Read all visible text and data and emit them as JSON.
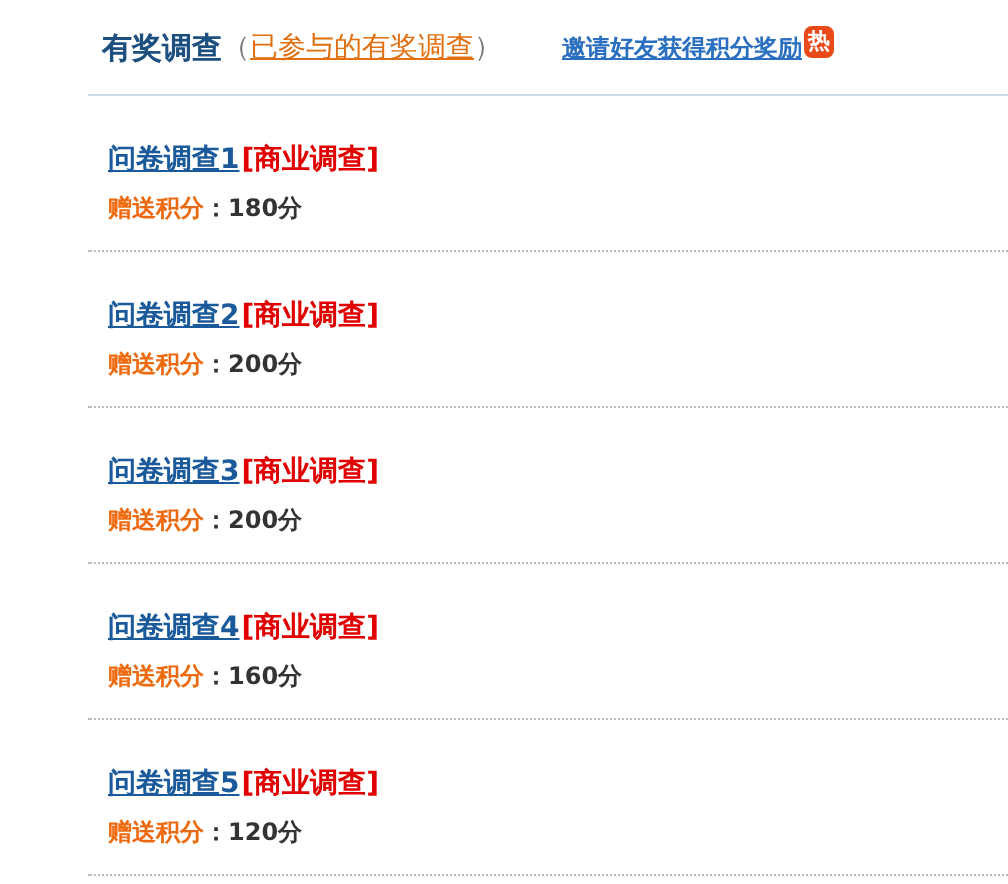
{
  "header": {
    "title": "有奖调查",
    "paren_open": "（",
    "participated_link": "已参与的有奖调查",
    "paren_close": "）",
    "invite_link": "邀请好友获得积分奖励",
    "hot_badge": "热"
  },
  "surveys": [
    {
      "title": "问卷调查1",
      "tag": "[商业调查]",
      "points_label": "赠送积分",
      "points_value": "：180分"
    },
    {
      "title": "问卷调查2",
      "tag": "[商业调查]",
      "points_label": "赠送积分",
      "points_value": "：200分"
    },
    {
      "title": "问卷调查3",
      "tag": "[商业调查]",
      "points_label": "赠送积分",
      "points_value": "：200分"
    },
    {
      "title": "问卷调查4",
      "tag": "[商业调查]",
      "points_label": "赠送积分",
      "points_value": "：160分"
    },
    {
      "title": "问卷调查5",
      "tag": "[商业调查]",
      "points_label": "赠送积分",
      "points_value": "：120分"
    }
  ]
}
